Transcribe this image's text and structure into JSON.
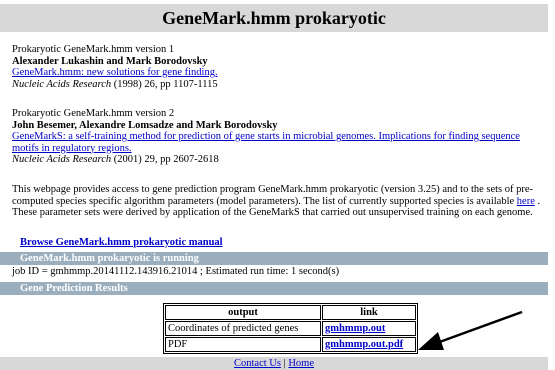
{
  "header": {
    "title": "GeneMark.hmm prokaryotic"
  },
  "refs": [
    {
      "version": "Prokaryotic GeneMark.hmm version 1",
      "authors": "Alexander Lukashin and Mark Borodovsky",
      "link": "GeneMark.hmm: new solutions for gene finding.",
      "journal": "Nucleic Acids Research",
      "citation": " (1998) 26, pp 1107-1115"
    },
    {
      "version": "Prokaryotic GeneMark.hmm version 2",
      "authors": "John Besemer, Alexandre Lomsadze and Mark Borodovsky",
      "link": "GeneMarkS: a self-training method for prediction of gene starts in microbial genomes. Implications for finding sequence motifs in regulatory regions.",
      "journal": "Nucleic Acids Research",
      "citation": " (2001) 29, pp 2607-2618"
    }
  ],
  "description": {
    "before": "This webpage provides access to gene prediction program GeneMark.hmm prokaryotic (version 3.25) and to the sets of pre-computed species specific algorithm parameters (model parameters). The list of currently supported species is available ",
    "link": "here",
    "after": " . These parameter sets were derived by application of the GeneMarkS that carried out unsupervised training on each genome."
  },
  "manual_link": "Browse GeneMark.hmm prokaryotic manual",
  "running_bar": "GeneMark.hmm prokaryotic is running",
  "job_line": "job ID = gmhmmp.20141112.143916.21014 ; Estimated run time: 1 second(s)",
  "results_bar": "Gene Prediction Results",
  "results": {
    "headers": [
      "output",
      "link"
    ],
    "rows": [
      {
        "output": "Coordinates of predicted genes",
        "link": "gmhmmp.out"
      },
      {
        "output": "PDF",
        "link": "gmhmmp.out.pdf"
      }
    ]
  },
  "footer": {
    "contact": "Contact Us",
    "separator": "|",
    "home": "Home"
  }
}
